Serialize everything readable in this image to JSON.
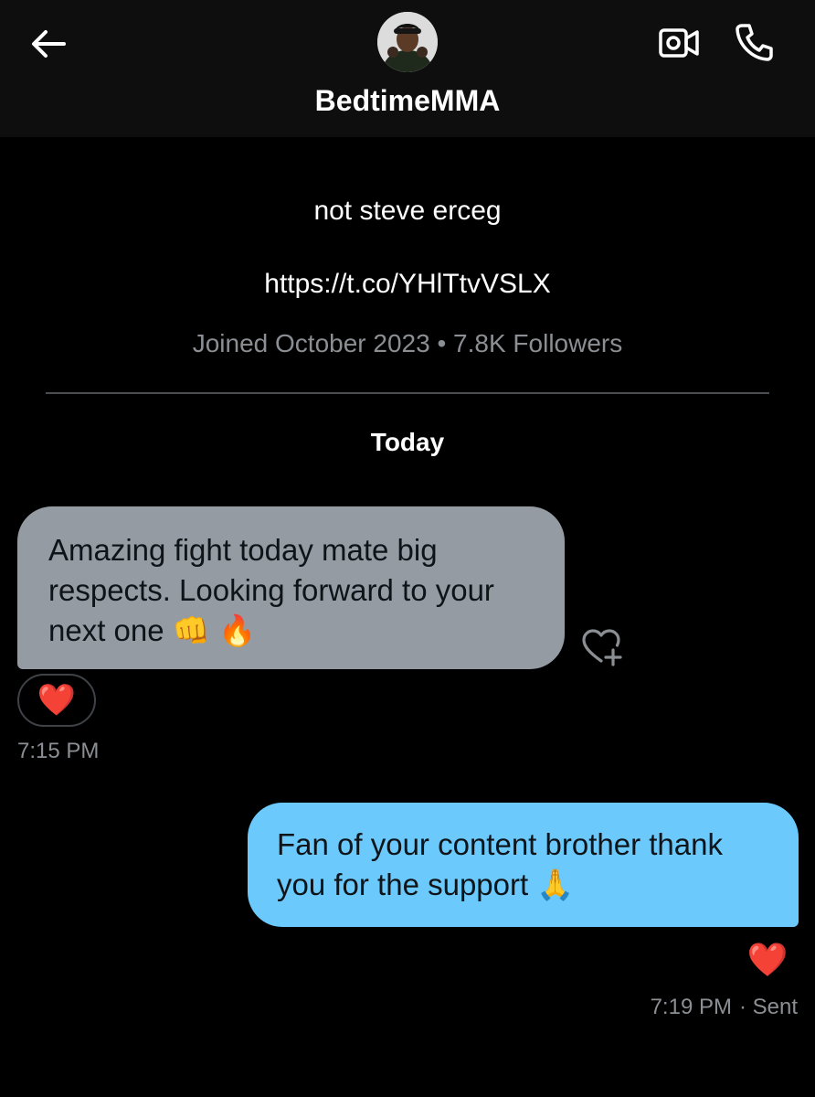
{
  "header": {
    "title": "BedtimeMMA",
    "back_icon": "arrow-left-icon",
    "video_icon": "video-camera-icon",
    "call_icon": "phone-icon"
  },
  "profile": {
    "bio": "not steve erceg",
    "link": "https://t.co/YHlTtvVSLX",
    "meta": "Joined October 2023 • 7.8K Followers"
  },
  "conversation": {
    "date_separator": "Today",
    "messages": [
      {
        "direction": "incoming",
        "text": "Amazing fight today mate big respects. Looking forward to your next one 👊 🔥",
        "reaction": "❤️",
        "time": "7:15 PM"
      },
      {
        "direction": "outgoing",
        "text": "Fan of your content brother thank you for the support 🙏",
        "reaction": "❤️",
        "time": "7:19 PM",
        "status": "· Sent"
      }
    ]
  },
  "colors": {
    "background": "#000000",
    "header_background": "#0e0e0e",
    "incoming_bubble": "#959ba3",
    "outgoing_bubble": "#6bc9fb",
    "muted_text": "#8b8f94",
    "heart": "#e0245e"
  }
}
